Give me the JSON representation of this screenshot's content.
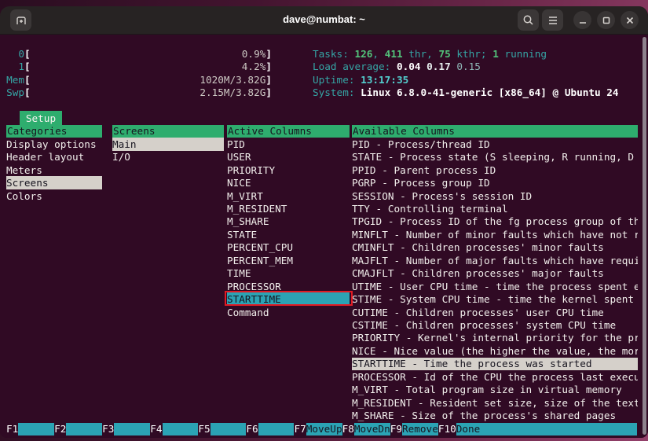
{
  "window": {
    "title": "dave@numbat: ~"
  },
  "header": {
    "meters": [
      {
        "label": "0",
        "value": "0.9%",
        "bars": [
          "green"
        ]
      },
      {
        "label": "1",
        "value": "4.2%",
        "bars": [
          "green",
          "red",
          "red"
        ]
      },
      {
        "label": "Mem",
        "value": "1020M/3.82G",
        "bars": [
          "green",
          "green",
          "green",
          "green",
          "green",
          "green",
          "green",
          "green",
          "green",
          "green",
          "green",
          "green",
          "magenta",
          "blue",
          "tan",
          "tan",
          "tan",
          "tan",
          "tan",
          "tan",
          "tan",
          "tan",
          "tan",
          "tan",
          "tan",
          "tan",
          "tan",
          "tan"
        ]
      },
      {
        "label": "Swp",
        "value": "2.15M/3.82G",
        "bars": [
          "red",
          "tan"
        ]
      }
    ],
    "info": {
      "tasks": {
        "label": "Tasks: ",
        "n1": "126",
        "s1": ", ",
        "n2": "411",
        "s2": " thr, ",
        "n3": "75",
        "s3": " kthr; ",
        "n4": "1",
        "s4": " running"
      },
      "load": {
        "label": "Load average: ",
        "v1": "0.04",
        "sp1": " ",
        "v2": "0.17",
        "sp2": " ",
        "v3": "0.15"
      },
      "uptime": {
        "label": "Uptime: ",
        "value": "13:17:35"
      },
      "system": {
        "label": "System: ",
        "value": "Linux 6.8.0-41-generic [x86_64] @ Ubuntu 24"
      }
    }
  },
  "setup": {
    "tab": "Setup",
    "panels": {
      "categories": {
        "title": "Categories",
        "selected_index": 3,
        "items": [
          "Display options",
          "Header layout",
          "Meters",
          "Screens",
          "Colors"
        ]
      },
      "screens": {
        "title": "Screens",
        "selected_index": 0,
        "items": [
          "Main",
          "I/O"
        ]
      },
      "active": {
        "title": "Active Columns",
        "selected_index": 12,
        "items": [
          "PID",
          "USER",
          "PRIORITY",
          "NICE",
          "M_VIRT",
          "M_RESIDENT",
          "M_SHARE",
          "STATE",
          "PERCENT_CPU",
          "PERCENT_MEM",
          "TIME",
          "PROCESSOR",
          "STARTTIME",
          "Command"
        ]
      },
      "available": {
        "title": "Available Columns",
        "selected_index": 17,
        "items": [
          "PID - Process/thread ID",
          "STATE - Process state (S sleeping, R running, D",
          "PPID - Parent process ID",
          "PGRP - Process group ID",
          "SESSION - Process's session ID",
          "TTY - Controlling terminal",
          "TPGID - Process ID of the fg process group of th",
          "MINFLT - Number of minor faults which have not r",
          "CMINFLT - Children processes' minor faults",
          "MAJFLT - Number of major faults which have requi",
          "CMAJFLT - Children processes' major faults",
          "UTIME - User CPU time - time the process spent e",
          "STIME - System CPU time - time the kernel spent",
          "CUTIME - Children processes' user CPU time",
          "CSTIME - Children processes' system CPU time",
          "PRIORITY - Kernel's internal priority for the pr",
          "NICE - Nice value (the higher the value, the mor",
          "STARTTIME - Time the process was started",
          "PROCESSOR - Id of the CPU the process last execu",
          "M_VIRT - Total program size in virtual memory",
          "M_RESIDENT - Resident set size, size of the text",
          "M_SHARE - Size of the process's shared pages"
        ]
      }
    }
  },
  "fnbar": {
    "keys": [
      {
        "key": "F1",
        "label": ""
      },
      {
        "key": "F2",
        "label": ""
      },
      {
        "key": "F3",
        "label": ""
      },
      {
        "key": "F4",
        "label": ""
      },
      {
        "key": "F5",
        "label": ""
      },
      {
        "key": "F6",
        "label": ""
      },
      {
        "key": "F7",
        "label": "MoveUp"
      },
      {
        "key": "F8",
        "label": "MoveDn"
      },
      {
        "key": "F9",
        "label": "Remove"
      },
      {
        "key": "F10",
        "label": "Done"
      }
    ]
  },
  "colors": {
    "term_bg": "#300a24",
    "accent_green": "#2ead6e",
    "accent_cyan": "#2ba3b4",
    "selection_gray": "#d5d0ca",
    "annotation_red": "#e01b24",
    "bar_green": "#3fa271",
    "bar_red": "#a93340",
    "bar_tan": "#97764f",
    "bar_magenta": "#aa66aa",
    "bar_blue": "#5a84c4"
  }
}
